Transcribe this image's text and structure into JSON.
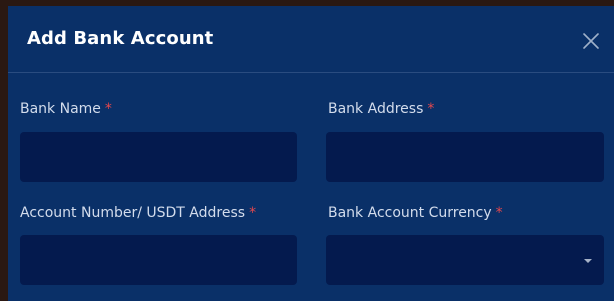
{
  "modal": {
    "title": "Add Bank Account",
    "close_icon": "close-icon"
  },
  "fields": {
    "bank_name": {
      "label": "Bank Name",
      "required_mark": "*",
      "value": ""
    },
    "bank_address": {
      "label": "Bank Address",
      "required_mark": "*",
      "value": ""
    },
    "account_number": {
      "label": "Account Number/ USDT Address",
      "required_mark": "*",
      "value": ""
    },
    "currency": {
      "label": "Bank Account Currency",
      "required_mark": "*",
      "selected": ""
    }
  },
  "colors": {
    "background": "#0a3068",
    "input_background": "#041a4e",
    "required": "#e5484d",
    "label": "#d3dcec"
  }
}
